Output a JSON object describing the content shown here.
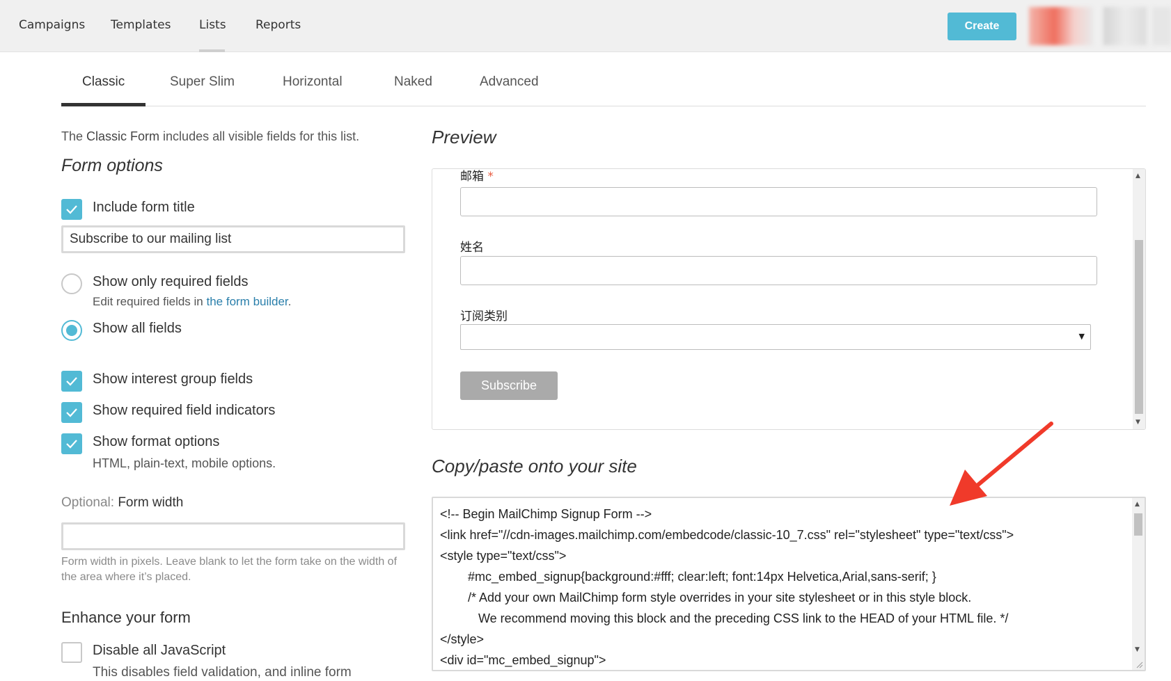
{
  "nav": {
    "items": [
      "Campaigns",
      "Templates",
      "Lists",
      "Reports"
    ],
    "active": "Lists",
    "create_label": "Create"
  },
  "tabs": {
    "items": [
      "Classic",
      "Super Slim",
      "Horizontal",
      "Naked",
      "Advanced"
    ],
    "active": "Classic"
  },
  "left": {
    "intro_prefix": "The ",
    "intro_bold": "Classic Form",
    "intro_suffix": " includes all visible fields for this list.",
    "form_options_title": "Form options",
    "include_title": {
      "label": "Include form title",
      "checked": true
    },
    "form_title_value": "Subscribe to our mailing list",
    "show_required_only": {
      "label": "Show only required fields",
      "selected": false
    },
    "required_sub_prefix": "Edit required fields in ",
    "required_sub_link": "the form builder",
    "required_sub_suffix": ".",
    "show_all_fields": {
      "label": "Show all fields",
      "selected": true
    },
    "show_interest_groups": {
      "label": "Show interest group fields",
      "checked": true
    },
    "show_required_indicators": {
      "label": "Show required field indicators",
      "checked": true
    },
    "show_format_options": {
      "label": "Show format options",
      "checked": true
    },
    "format_sub": "HTML, plain-text, mobile options.",
    "form_width_optional": "Optional:",
    "form_width_label": "Form width",
    "form_width_value": "",
    "form_width_help": "Form width in pixels. Leave blank to let the form take on the width of the area where it’s placed.",
    "enhance_title": "Enhance your form",
    "disable_js": {
      "label": "Disable all JavaScript",
      "checked": false
    },
    "disable_js_sub": "This disables field validation, and inline form"
  },
  "preview": {
    "title": "Preview",
    "email_label": "邮箱",
    "required_mark": "*",
    "name_label": "姓名",
    "category_label": "订阅类别",
    "category_value": "",
    "caret": "▼",
    "subscribe_label": "Subscribe"
  },
  "code": {
    "title": "Copy/paste onto your site",
    "lines": [
      "<!-- Begin MailChimp Signup Form -->",
      "<link href=\"//cdn-images.mailchimp.com/embedcode/classic-10_7.css\" rel=\"stylesheet\" type=\"text/css\">",
      "<style type=\"text/css\">",
      "        #mc_embed_signup{background:#fff; clear:left; font:14px Helvetica,Arial,sans-serif; }",
      "        /* Add your own MailChimp form style overrides in your site stylesheet or in this style block.",
      "           We recommend moving this block and the preceding CSS link to the HEAD of your HTML file. */",
      "</style>",
      "<div id=\"mc_embed_signup\">"
    ]
  },
  "colors": {
    "accent": "#52bad5",
    "annotation_arrow": "#f03a2a"
  }
}
